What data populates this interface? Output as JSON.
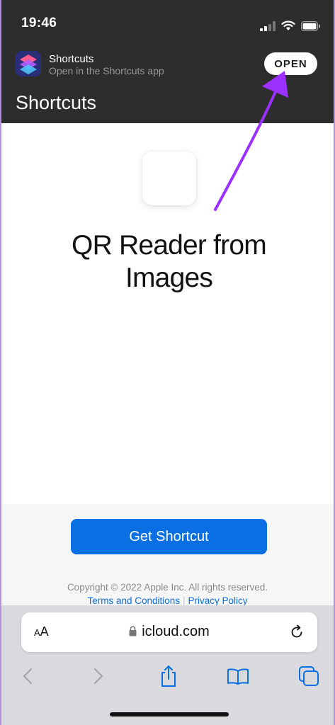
{
  "status_bar": {
    "time": "19:46",
    "icons": [
      "cellular-signal-icon",
      "wifi-icon",
      "battery-icon"
    ]
  },
  "app_banner": {
    "app_name": "Shortcuts",
    "subtitle": "Open in the Shortcuts app",
    "open_label": "OPEN",
    "icon": "shortcuts-app-icon"
  },
  "title_bar": {
    "title": "Shortcuts"
  },
  "main": {
    "shortcut_name": "QR Reader from Images",
    "get_button_label": "Get Shortcut"
  },
  "footer": {
    "copyright": "Copyright © 2022 Apple Inc. All rights reserved.",
    "terms_label": "Terms and Conditions",
    "separator": "|",
    "privacy_label": "Privacy Policy"
  },
  "safari": {
    "text_size_label_small": "A",
    "text_size_label_large": "A",
    "url": "icloud.com",
    "toolbar_icons": [
      "back-arrow-icon",
      "forward-arrow-icon",
      "share-icon",
      "bookmarks-icon",
      "tabs-icon"
    ]
  },
  "colors": {
    "dark_header": "#2d2d2d",
    "accent_blue": "#0a6fe2",
    "annotation_purple": "#9b30ff"
  }
}
